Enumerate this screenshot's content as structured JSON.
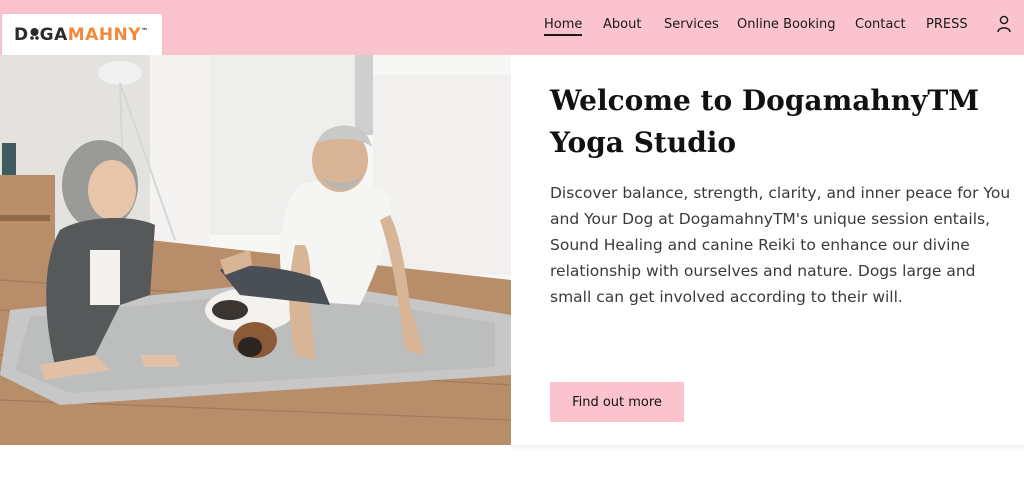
{
  "brand": {
    "logo_parts": [
      "D",
      "GA",
      "MAHNY",
      "™"
    ],
    "accent_color": "#f08a3c"
  },
  "colors": {
    "header_bg": "#fbc3ce",
    "button_bg": "#fbc3ce",
    "text": "#111111"
  },
  "nav": {
    "items": [
      {
        "label": "Home",
        "active": true
      },
      {
        "label": "About",
        "active": false
      },
      {
        "label": "Services",
        "active": false
      },
      {
        "label": "Online Booking",
        "active": false
      },
      {
        "label": "Contact",
        "active": false
      },
      {
        "label": "PRESS",
        "active": false
      }
    ],
    "account_icon": "user-icon"
  },
  "hero": {
    "title": "Welcome to DogamahnyTM Yoga Studio",
    "description": "Discover balance, strength, clarity, and inner peace for You and Your Dog at DogamahnyTM's unique session entails, Sound Healing and canine Reiki to enhance our divine relationship with ourselves and nature. Dogs large and small can get involved according to their will.",
    "cta_label": "Find out more"
  }
}
